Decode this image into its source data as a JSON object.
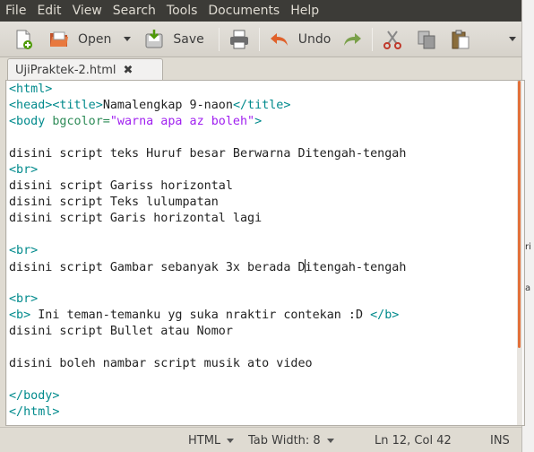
{
  "menubar": {
    "items": [
      "File",
      "Edit",
      "View",
      "Search",
      "Tools",
      "Documents",
      "Help"
    ]
  },
  "toolbar": {
    "new_icon": "new-document-icon",
    "open_label": "Open",
    "save_label": "Save",
    "print_icon": "print-icon",
    "undo_label": "Undo",
    "redo_icon": "redo-icon",
    "cut_icon": "cut-icon",
    "copy_icon": "copy-icon",
    "paste_icon": "paste-icon"
  },
  "tab": {
    "title": "UjiPraktek-2.html",
    "close_icon": "close-icon"
  },
  "editor": {
    "lines": [
      [
        {
          "t": "<html>",
          "c": "tag"
        }
      ],
      [
        {
          "t": "<head><title>",
          "c": "tag"
        },
        {
          "t": "Namalengkap 9-naon",
          "c": ""
        },
        {
          "t": "</title>",
          "c": "tag"
        }
      ],
      [
        {
          "t": "<body ",
          "c": "tag"
        },
        {
          "t": "bgcolor=",
          "c": "attr"
        },
        {
          "t": "\"warna apa az boleh\"",
          "c": "str"
        },
        {
          "t": ">",
          "c": "tag"
        }
      ],
      [],
      [
        {
          "t": "disini script teks Huruf besar Berwarna Ditengah-tengah",
          "c": ""
        }
      ],
      [
        {
          "t": "<br>",
          "c": "tag"
        }
      ],
      [
        {
          "t": "disini script Gariss horizontal",
          "c": ""
        }
      ],
      [
        {
          "t": "disini script Teks lulumpatan",
          "c": ""
        }
      ],
      [
        {
          "t": "disini script Garis horizontal lagi",
          "c": ""
        }
      ],
      [],
      [
        {
          "t": "<br>",
          "c": "tag"
        }
      ],
      [
        {
          "t": "disini script Gambar sebanyak 3x berada D",
          "c": ""
        },
        {
          "t": "",
          "c": "caret"
        },
        {
          "t": "itengah-tengah",
          "c": ""
        }
      ],
      [],
      [
        {
          "t": "<br>",
          "c": "tag"
        }
      ],
      [
        {
          "t": "<b>",
          "c": "tag"
        },
        {
          "t": " Ini teman-temanku yg suka nraktir contekan :D ",
          "c": ""
        },
        {
          "t": "</b>",
          "c": "tag"
        }
      ],
      [
        {
          "t": "disini script Bullet atau Nomor",
          "c": ""
        }
      ],
      [],
      [
        {
          "t": "disini boleh nambar script musik ato video",
          "c": ""
        }
      ],
      [],
      [
        {
          "t": "</body>",
          "c": "tag"
        }
      ],
      [
        {
          "t": "</html>",
          "c": "tag"
        }
      ]
    ]
  },
  "statusbar": {
    "language": "HTML",
    "tab_width": "Tab Width: 8",
    "position": "Ln 12, Col 42",
    "mode": "INS"
  },
  "background_fragments": [
    "ri",
    "a"
  ]
}
